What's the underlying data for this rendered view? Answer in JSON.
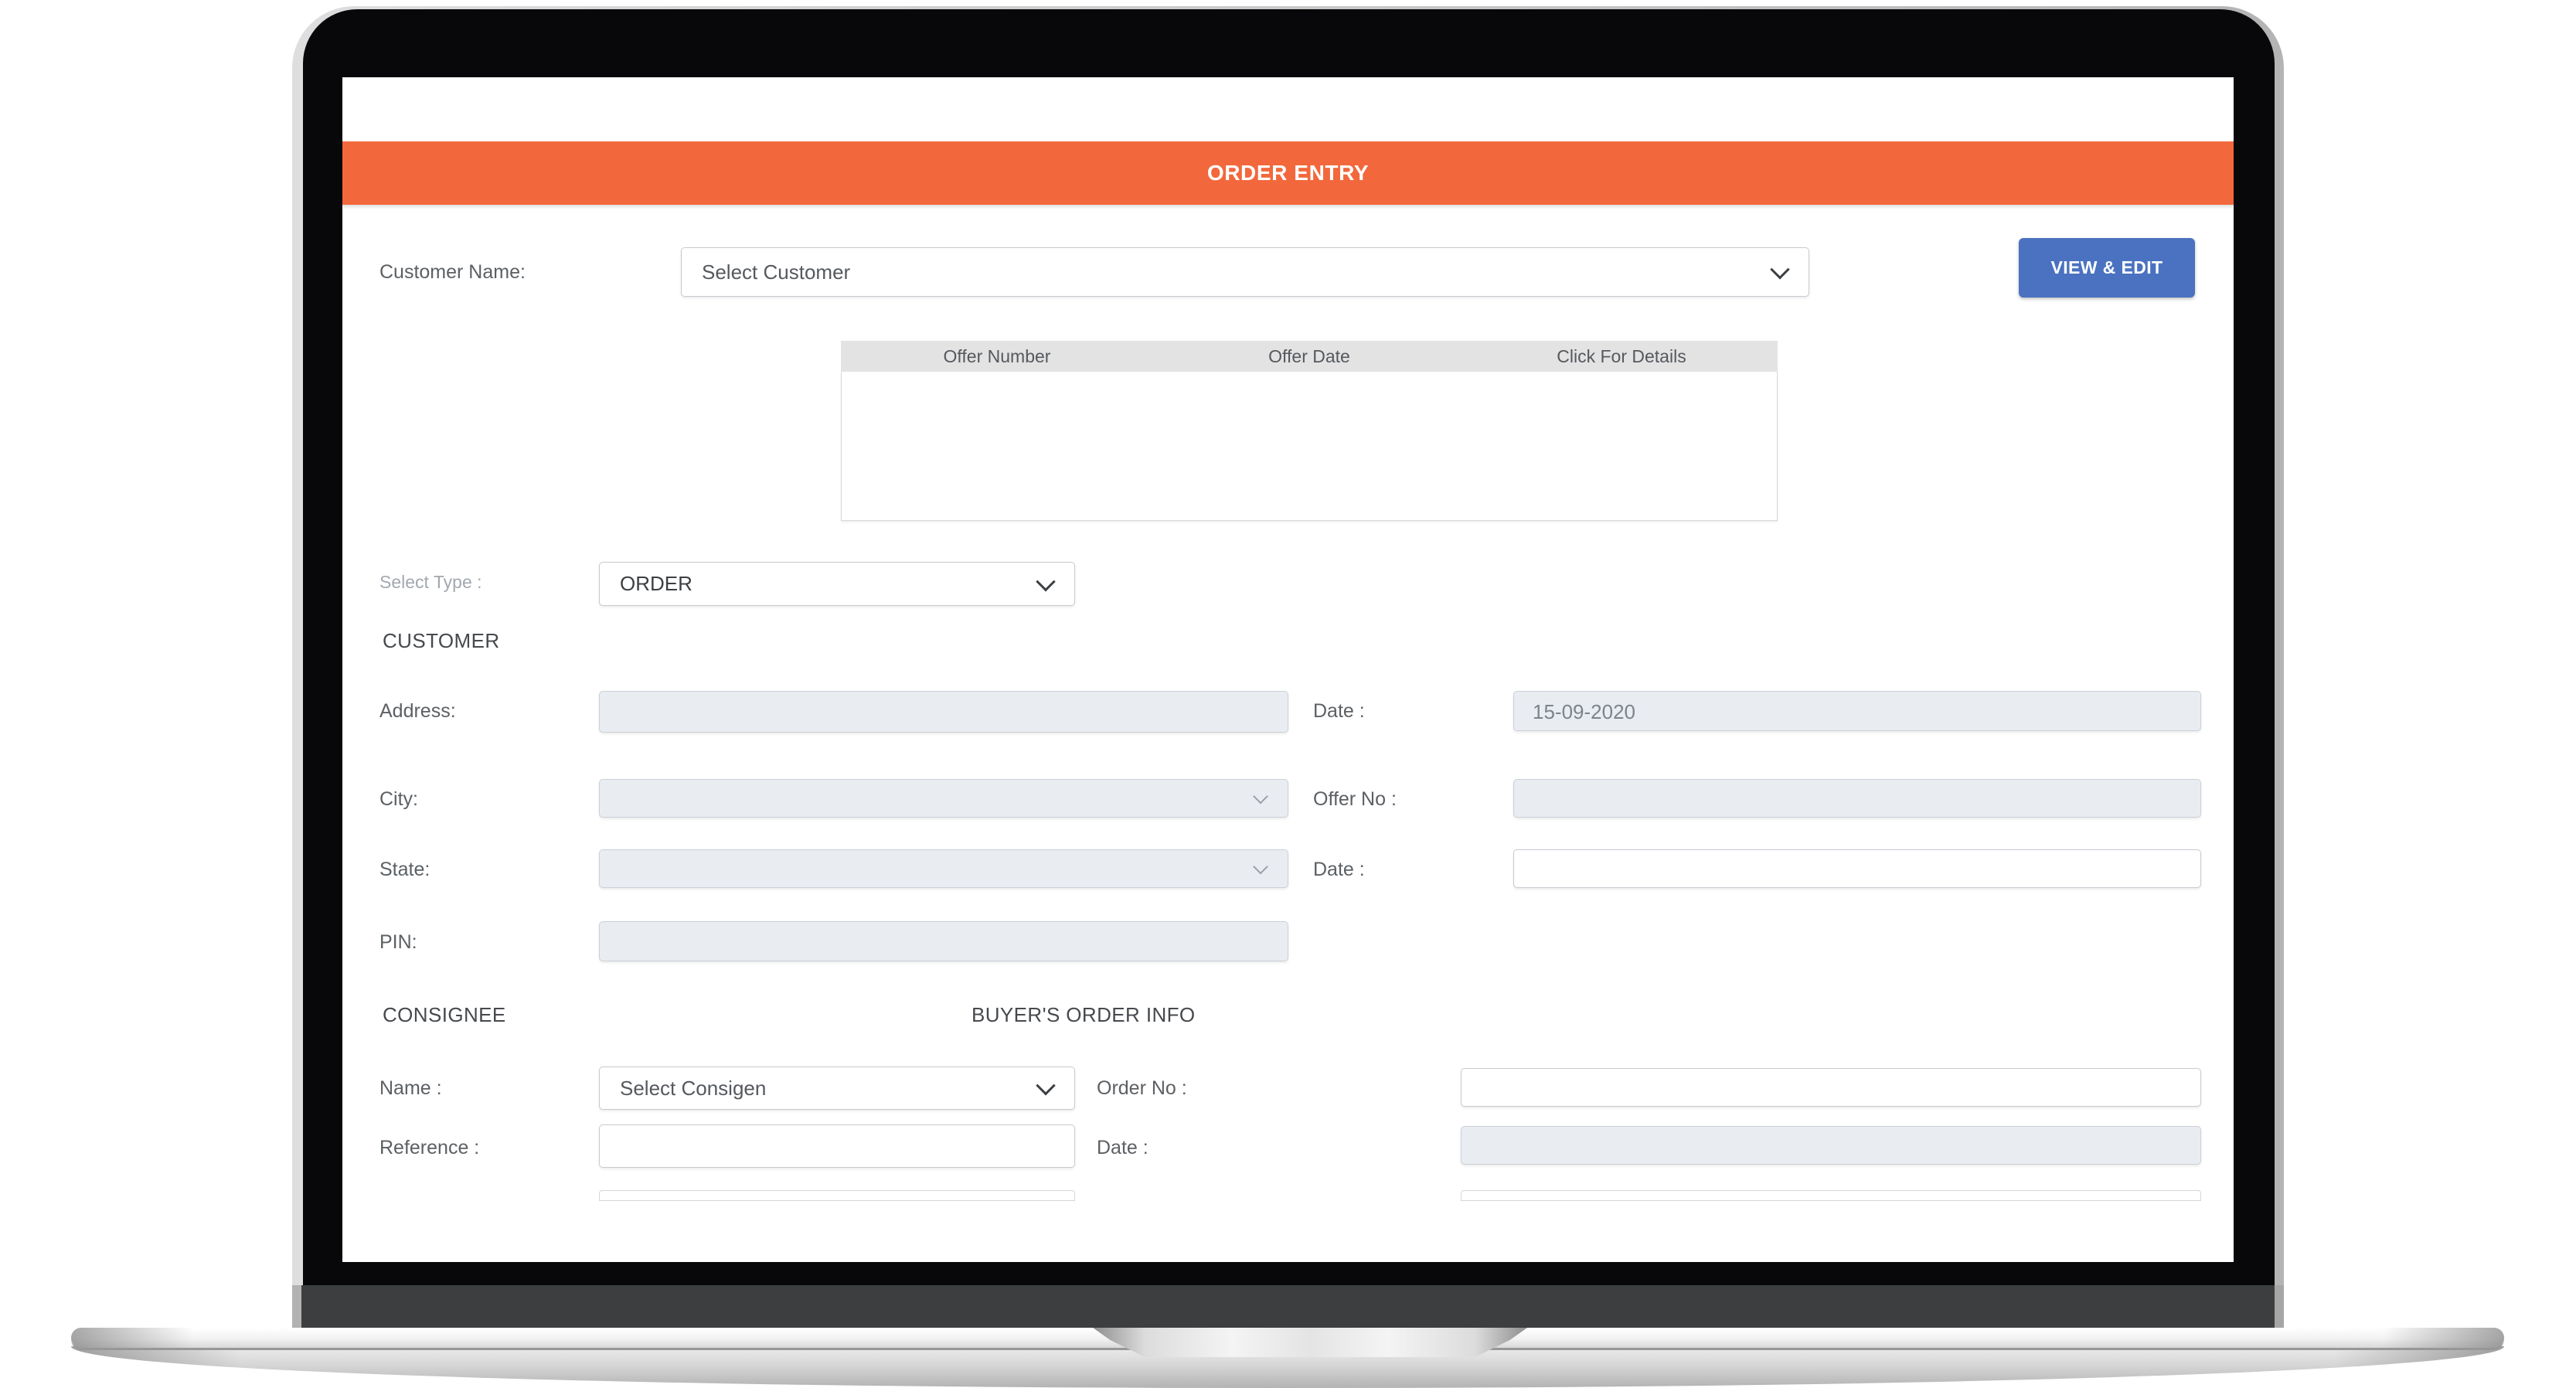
{
  "colors": {
    "accent_orange": "#f2683c",
    "button_blue": "#4a72c0",
    "disabled_field_bg": "#e9edf2"
  },
  "header": {
    "title": "ORDER ENTRY"
  },
  "customer_row": {
    "label": "Customer Name:",
    "select_value": "Select Customer",
    "button_label": "VIEW & EDIT"
  },
  "offers_table": {
    "columns": [
      "Offer Number",
      "Offer Date",
      "Click For Details"
    ],
    "rows": []
  },
  "type_row": {
    "label": "Select Type :",
    "select_value": "ORDER"
  },
  "customer_section": {
    "heading": "CUSTOMER",
    "address_label": "Address:",
    "city_label": "City:",
    "state_label": "State:",
    "pin_label": "PIN:",
    "date_label": "Date :",
    "date_value": "15-09-2020",
    "offer_no_label": "Offer No :",
    "offer_date_label": "Date :"
  },
  "consignee_section": {
    "heading": "CONSIGNEE",
    "name_label": "Name :",
    "name_value": "Select Consigen",
    "reference_label": "Reference :"
  },
  "buyers_section": {
    "heading": "BUYER'S ORDER INFO",
    "order_no_label": "Order No :",
    "date_label": "Date :"
  }
}
